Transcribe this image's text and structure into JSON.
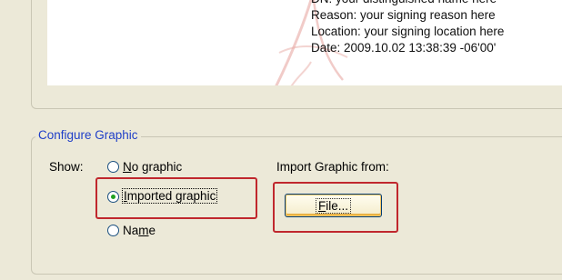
{
  "preview": {
    "lines": [
      "DN: your distinguished name here",
      "Reason: your signing reason here",
      "Location: your signing location here",
      "Date: 2009.10.02 13:38:39 -06'00'"
    ]
  },
  "configure_graphic": {
    "legend": "Configure Graphic",
    "show_label": "Show:",
    "options": [
      {
        "prefix": "",
        "mnemonic": "N",
        "rest": "o graphic",
        "selected": false
      },
      {
        "prefix": "",
        "mnemonic": "I",
        "rest": "mported graphic",
        "selected": true
      },
      {
        "prefix": "Na",
        "mnemonic": "m",
        "rest": "e",
        "selected": false
      }
    ],
    "import_label": "Import Graphic from:",
    "file_button": {
      "prefix": "",
      "mnemonic": "F",
      "rest": "ile..."
    }
  },
  "colors": {
    "highlight": "#c0272d",
    "legend_text": "#1f3fc8",
    "dialog_background": "#ece9d8"
  }
}
